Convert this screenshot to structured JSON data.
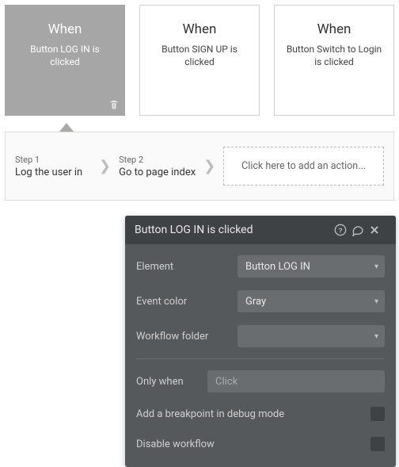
{
  "events": [
    {
      "when": "When",
      "desc": "Button LOG IN is clicked",
      "selected": true
    },
    {
      "when": "When",
      "desc": "Button SIGN UP is clicked",
      "selected": false
    },
    {
      "when": "When",
      "desc": "Button Switch to Login is clicked",
      "selected": false
    }
  ],
  "steps": [
    {
      "label": "Step 1",
      "text": "Log the user in"
    },
    {
      "label": "Step 2",
      "text": "Go to page index"
    }
  ],
  "add_action_text": "Click here to add an action...",
  "panel": {
    "title": "Button LOG IN is clicked",
    "fields": {
      "element_label": "Element",
      "element_value": "Button LOG IN",
      "color_label": "Event color",
      "color_value": "Gray",
      "folder_label": "Workflow folder",
      "folder_value": "",
      "only_when_label": "Only when",
      "only_when_placeholder": "Click",
      "breakpoint_label": "Add a breakpoint in debug mode",
      "disable_label": "Disable workflow"
    }
  }
}
